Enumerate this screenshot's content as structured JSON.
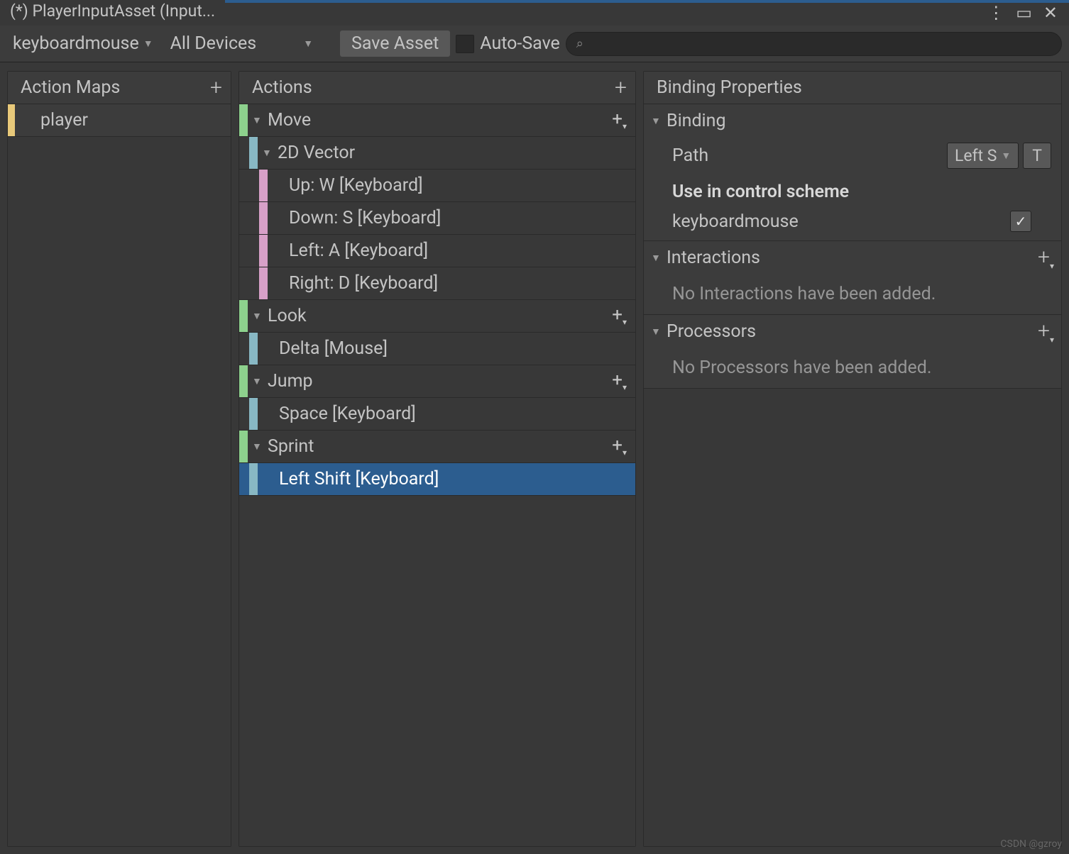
{
  "window": {
    "title": "(*) PlayerInputAsset (Input..."
  },
  "toolbar": {
    "scheme": "keyboardmouse",
    "devices": "All Devices",
    "save": "Save Asset",
    "autoSave": "Auto-Save"
  },
  "panels": {
    "actionMaps": "Action Maps",
    "actions": "Actions",
    "bindingProps": "Binding Properties"
  },
  "actionMaps": [
    {
      "name": "player",
      "color": "#e8c97a",
      "selected": true
    }
  ],
  "actions": [
    {
      "name": "Move",
      "children": [
        {
          "name": "2D Vector",
          "type": "composite",
          "children": [
            {
              "name": "Up: W [Keyboard]"
            },
            {
              "name": "Down: S [Keyboard]"
            },
            {
              "name": "Left: A [Keyboard]"
            },
            {
              "name": "Right: D [Keyboard]"
            }
          ]
        }
      ]
    },
    {
      "name": "Look",
      "children": [
        {
          "name": "Delta [Mouse]",
          "type": "lookbinding"
        }
      ]
    },
    {
      "name": "Jump",
      "children": [
        {
          "name": "Space [Keyboard]",
          "type": "lookbinding"
        }
      ]
    },
    {
      "name": "Sprint",
      "children": [
        {
          "name": "Left Shift [Keyboard]",
          "type": "lookbinding",
          "selected": true
        }
      ]
    }
  ],
  "properties": {
    "bindingSection": "Binding",
    "pathLabel": "Path",
    "pathValue": "Left S",
    "tButton": "T",
    "useInScheme": "Use in control scheme",
    "schemeName": "keyboardmouse",
    "interactionsSection": "Interactions",
    "noInteractions": "No Interactions have been added.",
    "processorsSection": "Processors",
    "noProcessors": "No Processors have been added."
  },
  "watermark": "CSDN @gzroy"
}
